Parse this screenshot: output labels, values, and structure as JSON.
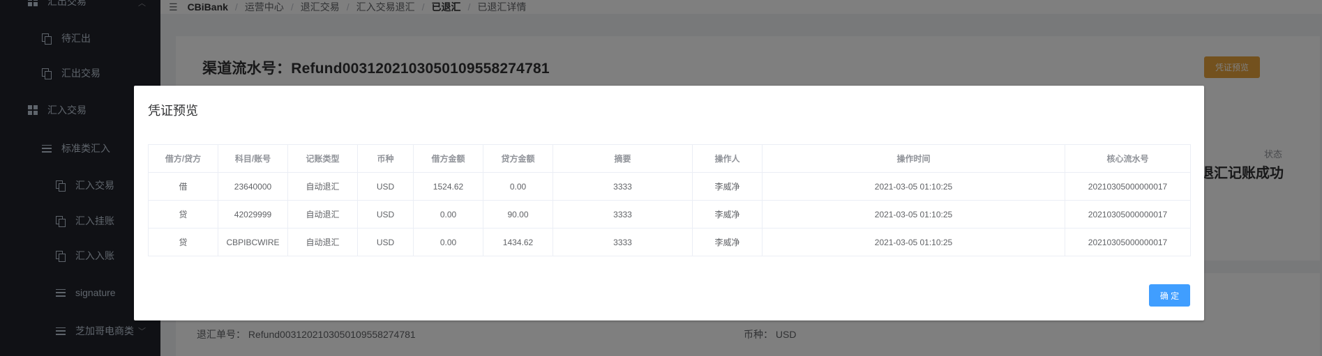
{
  "topbar": {
    "brand": "CBiBank",
    "breadcrumbs": [
      "运营中心",
      "退汇交易",
      "汇入交易退汇",
      "已退汇",
      "已退汇详情"
    ]
  },
  "sidebar": {
    "items": [
      {
        "label": "汇出交易",
        "icon": "grid-icon"
      },
      {
        "label": "待汇出",
        "icon": "copy-icon"
      },
      {
        "label": "汇出交易",
        "icon": "copy-icon"
      },
      {
        "label": "汇入交易",
        "icon": "grid-icon"
      },
      {
        "label": "标准类汇入",
        "icon": "list-icon"
      },
      {
        "label": "汇入交易",
        "icon": "copy-icon"
      },
      {
        "label": "汇入挂账",
        "icon": "copy-icon"
      },
      {
        "label": "汇入入账",
        "icon": "copy-icon"
      },
      {
        "label": "signature",
        "icon": "list-icon"
      },
      {
        "label": "芝加哥电商类",
        "icon": "list-icon"
      }
    ]
  },
  "main": {
    "channel_title": "渠道流水号：Refund0031202103050109558274781",
    "voucher_button": "凭证预览",
    "status_label": "状态",
    "status_value": "退汇记账成功",
    "refund_no_label": "退汇单号：",
    "refund_no_value": "Refund0031202103050109558274781",
    "currency_label": "币种：",
    "currency_value": "USD"
  },
  "dialog": {
    "title": "凭证预览",
    "columns": [
      "借方/贷方",
      "科目/账号",
      "记账类型",
      "币种",
      "借方金额",
      "贷方金额",
      "摘要",
      "操作人",
      "操作时间",
      "核心流水号"
    ],
    "rows": [
      [
        "借",
        "23640000",
        "自动退汇",
        "USD",
        "1524.62",
        "0.00",
        "3333",
        "李威净",
        "2021-03-05 01:10:25",
        "20210305000000017"
      ],
      [
        "贷",
        "42029999",
        "自动退汇",
        "USD",
        "0.00",
        "90.00",
        "3333",
        "李威净",
        "2021-03-05 01:10:25",
        "20210305000000017"
      ],
      [
        "贷",
        "CBPIBCWIRE",
        "自动退汇",
        "USD",
        "0.00",
        "1434.62",
        "3333",
        "李威净",
        "2021-03-05 01:10:25",
        "20210305000000017"
      ]
    ],
    "ok_button": "确 定"
  },
  "colors": {
    "sidebar_bg": "#20222a",
    "primary": "#409eff",
    "warning": "#e6a23c"
  }
}
